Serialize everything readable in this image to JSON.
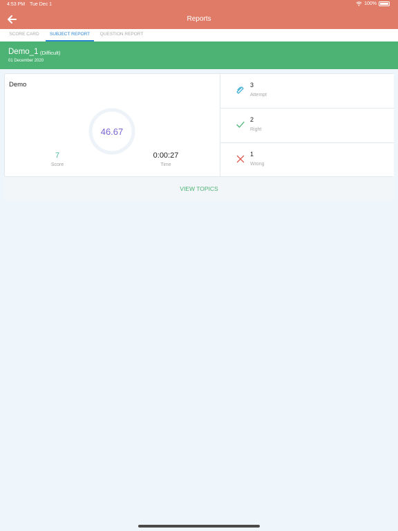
{
  "status_bar": {
    "time": "4:53 PM",
    "date": "Tue Dec 1",
    "battery": "100%"
  },
  "header": {
    "title": "Reports"
  },
  "tabs": [
    {
      "label": "SCORE CARD",
      "active": false
    },
    {
      "label": "SUBJECT REPORT",
      "active": true
    },
    {
      "label": "QUESTION REPORT",
      "active": false
    }
  ],
  "exam": {
    "name": "Demo_1",
    "level": "(Difficult)",
    "date": "01 December 2020"
  },
  "subject": {
    "name": "Demo",
    "percentage": "46.67",
    "score_value": "7",
    "score_label": "Score",
    "time_value": "0:00:27",
    "time_label": "Time"
  },
  "stats": [
    {
      "value": "3",
      "label": "Attempt",
      "icon": "pencil-icon"
    },
    {
      "value": "2",
      "label": "Right",
      "icon": "check-icon"
    },
    {
      "value": "1",
      "label": "Wrong",
      "icon": "cross-icon"
    }
  ],
  "view_topics_label": "VIEW TOPICS",
  "colors": {
    "header": "#e07b68",
    "banner": "#4cb374",
    "tab_active": "#2a84d2",
    "percent": "#7a64cf",
    "score": "#4ab4a0",
    "wrong": "#e05a4f"
  }
}
